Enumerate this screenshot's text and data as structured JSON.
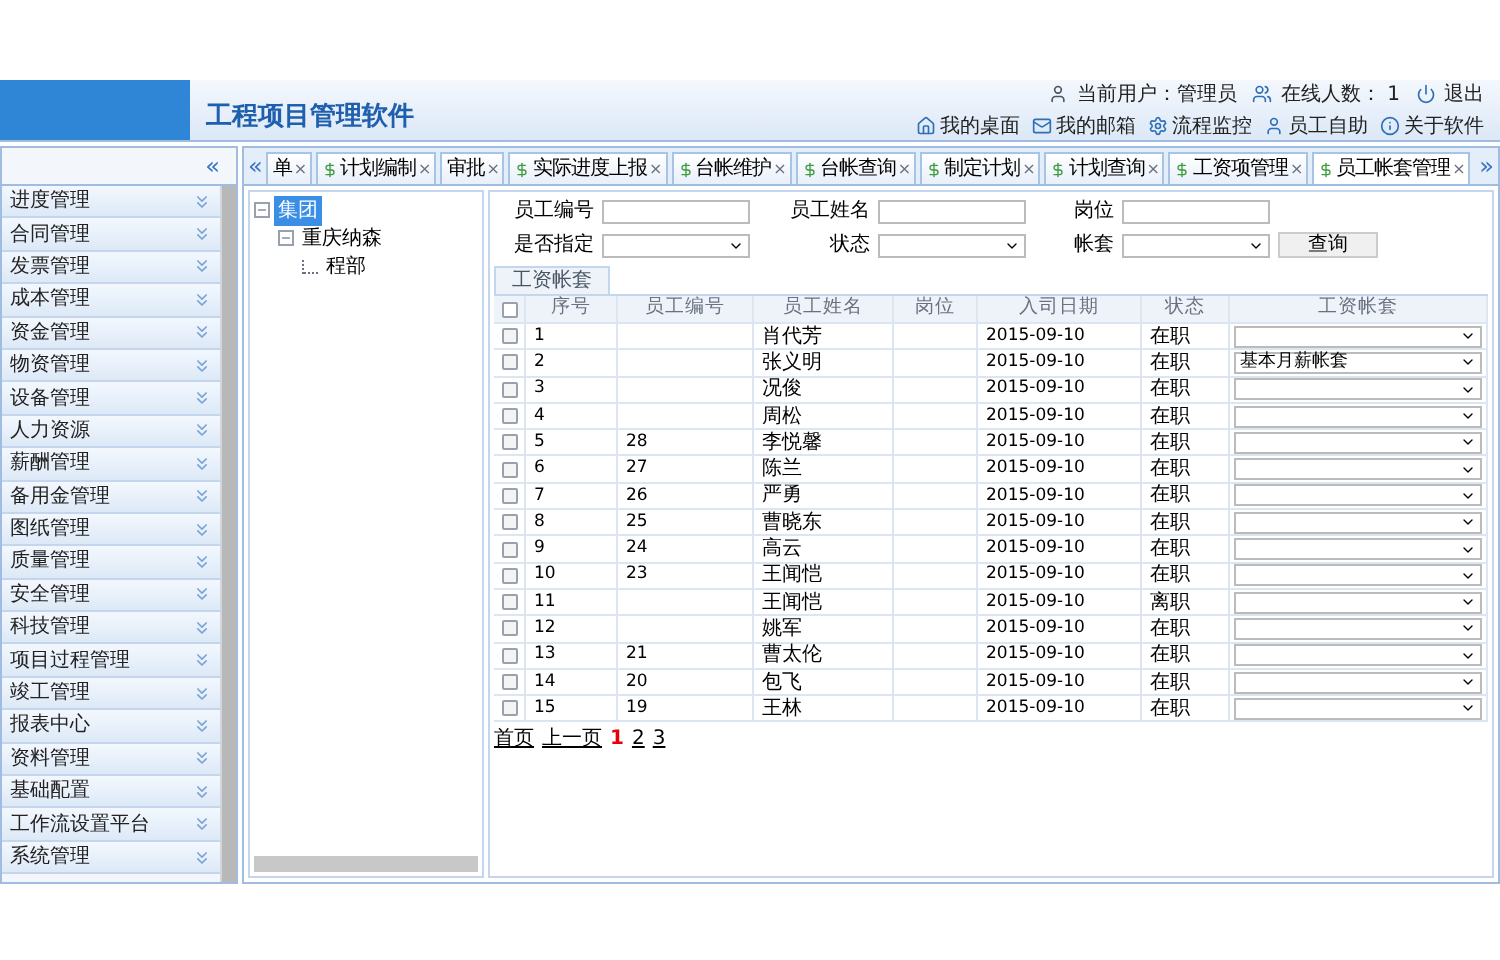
{
  "header": {
    "title": "工程项目管理软件",
    "user_label": "当前用户：",
    "user": "管理员",
    "online_label": "在线人数：",
    "online": "1",
    "logout": "退出",
    "links": [
      "我的桌面",
      "我的邮箱",
      "流程监控",
      "员工自助",
      "关于软件"
    ]
  },
  "sidebar": {
    "collapse": "«",
    "items": [
      {
        "label": "进度管理"
      },
      {
        "label": "合同管理"
      },
      {
        "label": "发票管理"
      },
      {
        "label": "成本管理"
      },
      {
        "label": "资金管理"
      },
      {
        "label": "物资管理"
      },
      {
        "label": "设备管理"
      },
      {
        "label": "人力资源"
      },
      {
        "label": "薪酬管理"
      },
      {
        "label": "备用金管理"
      },
      {
        "label": "图纸管理"
      },
      {
        "label": "质量管理"
      },
      {
        "label": "安全管理"
      },
      {
        "label": "科技管理"
      },
      {
        "label": "项目过程管理"
      },
      {
        "label": "竣工管理"
      },
      {
        "label": "报表中心"
      },
      {
        "label": "资料管理"
      },
      {
        "label": "基础配置"
      },
      {
        "label": "工作流设置平台"
      },
      {
        "label": "系统管理"
      }
    ]
  },
  "tabs": {
    "prev": "«",
    "next": "»",
    "items": [
      {
        "label": "单",
        "close": "×",
        "selected": false,
        "icon": false
      },
      {
        "label": "计划编制",
        "close": "×",
        "selected": false,
        "icon": true
      },
      {
        "label": "审批",
        "close": "×",
        "selected": false,
        "icon": false
      },
      {
        "label": "实际进度上报",
        "close": "×",
        "selected": false,
        "icon": true
      },
      {
        "label": "台帐维护",
        "close": "×",
        "selected": false,
        "icon": true
      },
      {
        "label": "台帐查询",
        "close": "×",
        "selected": false,
        "icon": true
      },
      {
        "label": "制定计划",
        "close": "×",
        "selected": false,
        "icon": true
      },
      {
        "label": "计划查询",
        "close": "×",
        "selected": false,
        "icon": true
      },
      {
        "label": "工资项管理",
        "close": "×",
        "selected": false,
        "icon": true
      },
      {
        "label": "员工帐套管理",
        "close": "×",
        "selected": true,
        "icon": true
      }
    ]
  },
  "tree": [
    {
      "label": "集团",
      "selected": true,
      "children": [
        {
          "label": "重庆纳森",
          "selected": false,
          "children": [
            {
              "label": "程部",
              "selected": false
            }
          ]
        }
      ]
    }
  ],
  "filters": [
    {
      "kind": "text",
      "label": "员工编号"
    },
    {
      "kind": "text",
      "label": "员工姓名"
    },
    {
      "kind": "text",
      "label": "岗位"
    },
    {
      "kind": "select",
      "label": "是否指定"
    },
    {
      "kind": "select",
      "label": "状态"
    },
    {
      "kind": "select",
      "label": "帐套"
    }
  ],
  "search_button": "查询",
  "subtab": "工资帐套",
  "table": {
    "header_checked": false,
    "columns": [
      "序号",
      "员工编号",
      "员工姓名",
      "岗位",
      "入司日期",
      "状态",
      "工资帐套"
    ],
    "rows": [
      {
        "checked": false,
        "cells": [
          "1",
          "",
          "肖代芳",
          "",
          "2015-09-10",
          "在职",
          ""
        ]
      },
      {
        "checked": false,
        "cells": [
          "2",
          "",
          "张义明",
          "",
          "2015-09-10",
          "在职",
          "基本月薪帐套"
        ]
      },
      {
        "checked": false,
        "cells": [
          "3",
          "",
          "况俊",
          "",
          "2015-09-10",
          "在职",
          ""
        ]
      },
      {
        "checked": false,
        "cells": [
          "4",
          "",
          "周松",
          "",
          "2015-09-10",
          "在职",
          ""
        ]
      },
      {
        "checked": false,
        "cells": [
          "5",
          "28",
          "李悦馨",
          "",
          "2015-09-10",
          "在职",
          ""
        ]
      },
      {
        "checked": false,
        "cells": [
          "6",
          "27",
          "陈兰",
          "",
          "2015-09-10",
          "在职",
          ""
        ]
      },
      {
        "checked": false,
        "cells": [
          "7",
          "26",
          "严勇",
          "",
          "2015-09-10",
          "在职",
          ""
        ]
      },
      {
        "checked": false,
        "cells": [
          "8",
          "25",
          "曹晓东",
          "",
          "2015-09-10",
          "在职",
          ""
        ]
      },
      {
        "checked": false,
        "cells": [
          "9",
          "24",
          "高云",
          "",
          "2015-09-10",
          "在职",
          ""
        ]
      },
      {
        "checked": false,
        "cells": [
          "10",
          "23",
          "王闻恺",
          "",
          "2015-09-10",
          "在职",
          ""
        ]
      },
      {
        "checked": false,
        "cells": [
          "11",
          "",
          "王闻恺",
          "",
          "2015-09-10",
          "离职",
          ""
        ]
      },
      {
        "checked": false,
        "cells": [
          "12",
          "",
          "姚军",
          "",
          "2015-09-10",
          "在职",
          ""
        ]
      },
      {
        "checked": false,
        "cells": [
          "13",
          "21",
          "曹太伦",
          "",
          "2015-09-10",
          "在职",
          ""
        ]
      },
      {
        "checked": false,
        "cells": [
          "14",
          "20",
          "包飞",
          "",
          "2015-09-10",
          "在职",
          ""
        ]
      },
      {
        "checked": false,
        "cells": [
          "15",
          "19",
          "王林",
          "",
          "2015-09-10",
          "在职",
          ""
        ]
      }
    ]
  },
  "pager": {
    "first": "首页",
    "prev": "上一页",
    "pages": [
      {
        "label": "1",
        "selected": true
      },
      {
        "label": "2",
        "selected": false
      },
      {
        "label": "3",
        "selected": false
      }
    ]
  }
}
